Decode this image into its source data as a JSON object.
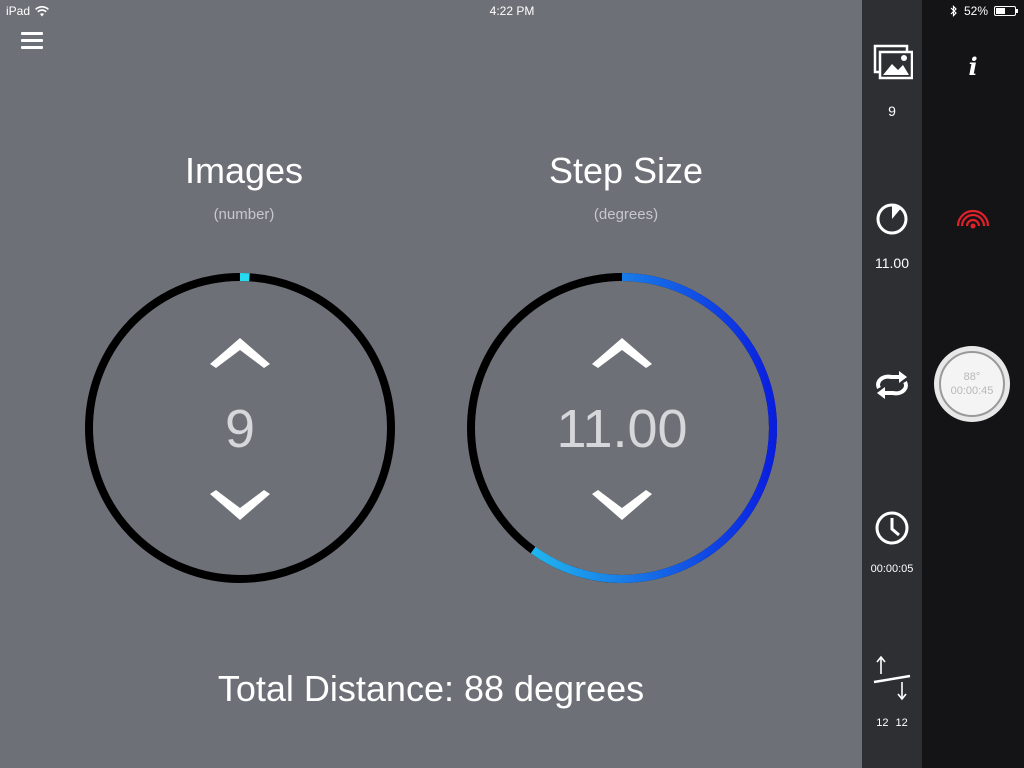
{
  "status_bar": {
    "device": "iPad",
    "time": "4:22 PM",
    "battery": "52%",
    "battery_level": 0.52
  },
  "dials": {
    "images": {
      "title": "Images",
      "unit": "(number)",
      "value": "9",
      "progress": 0.01
    },
    "step_size": {
      "title": "Step Size",
      "unit": "(degrees)",
      "value": "11.00",
      "progress": 0.6,
      "gradient_start": "#27dcf0",
      "gradient_end": "#0a1ee0"
    }
  },
  "total_distance": "Total Distance: 88 degrees",
  "toolbar": {
    "images_count": "9",
    "step_value": "11.00",
    "delay_value": "00:00:05",
    "level_left": "12",
    "level_right": "12"
  },
  "panel": {
    "info_label": "i",
    "start_degrees": "88°",
    "start_time": "00:00:45"
  },
  "colors": {
    "main_bg": "#6e7077",
    "toolbar_bg": "#2e2f33",
    "panel_bg": "#141416",
    "accent": "#27dcf0",
    "wireless_red": "#e0202a"
  }
}
